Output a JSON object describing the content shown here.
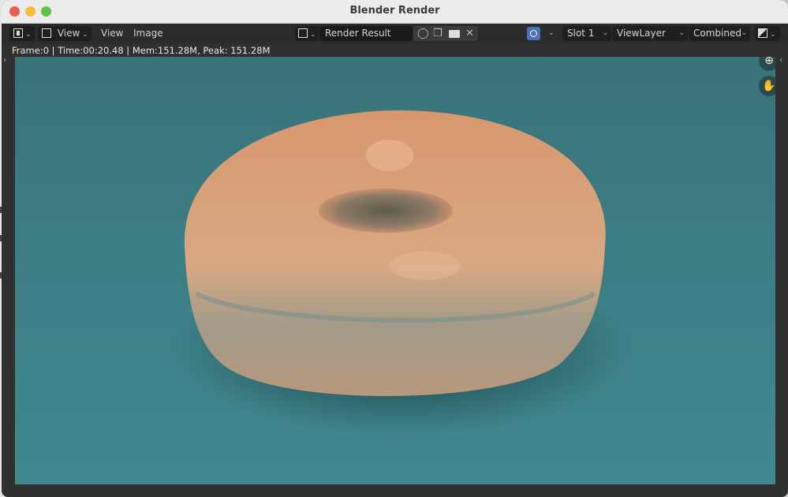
{
  "window": {
    "title": "Blender Render"
  },
  "header": {
    "editor_type_icon": "image-editor-icon",
    "view_mode_label": "View",
    "menus": [
      "View",
      "Image"
    ],
    "image_browse_icon": "image-browse-icon",
    "image_name": "Render Result",
    "fake_user_icon": "shield-icon",
    "duplicate_icon": "duplicate-icon",
    "open_icon": "folder-icon",
    "unlink_icon": "close-icon",
    "gizmo_icon": "overlay-gizmo-icon",
    "slot_label": "Slot 1",
    "view_layer_label": "ViewLayer",
    "pass_label": "Combined",
    "display_channels_icon": "display-channels-icon"
  },
  "status": {
    "text": "Frame:0 | Time:00:20.48 | Mem:151.28M, Peak: 151.28M"
  },
  "viewport": {
    "content": "Rendered image of a glazed donut (torus) on a teal background",
    "zoom_icon": "zoom-in-icon",
    "pan_icon": "hand-icon",
    "colors": {
      "background": "#3d7f86",
      "donut": "#d9a07c"
    }
  }
}
